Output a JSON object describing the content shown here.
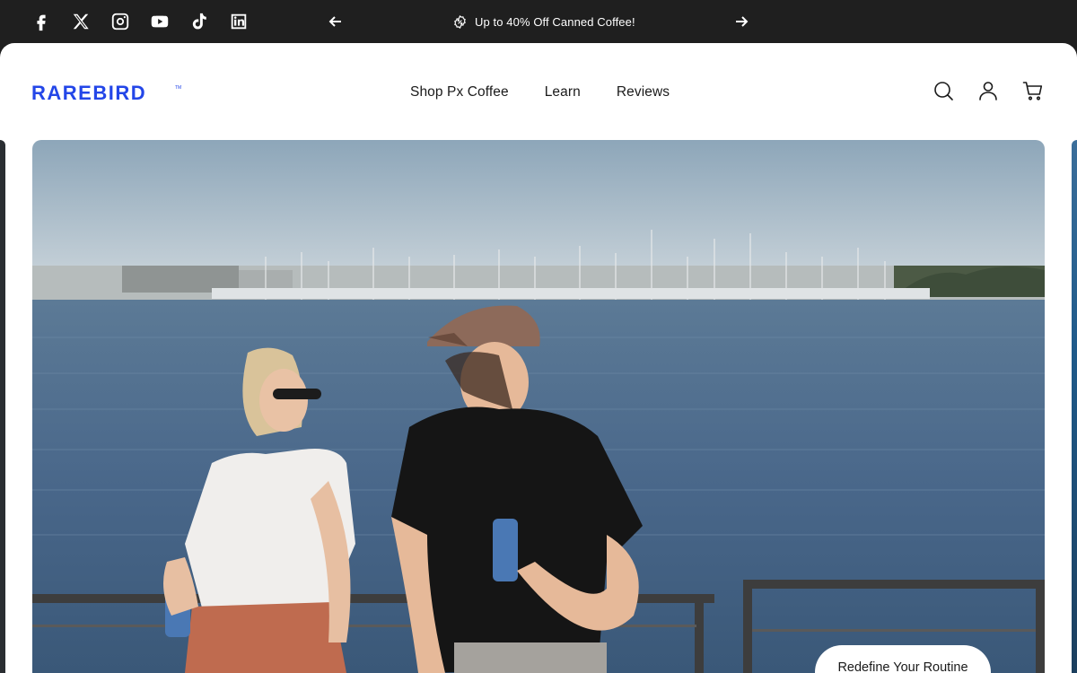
{
  "topbar": {
    "socials": [
      {
        "icon": "facebook-icon"
      },
      {
        "icon": "x-icon"
      },
      {
        "icon": "instagram-icon"
      },
      {
        "icon": "youtube-icon"
      },
      {
        "icon": "tiktok-icon"
      },
      {
        "icon": "linkedin-icon"
      }
    ],
    "promo_text": "Up to 40% Off Canned Coffee!",
    "promo_icon": "discount-badge-icon",
    "prev_icon": "arrow-left-icon",
    "next_icon": "arrow-right-icon"
  },
  "header": {
    "logo_text": "RAREBIRD",
    "nav": [
      {
        "label": "Shop Px Coffee"
      },
      {
        "label": "Learn"
      },
      {
        "label": "Reviews"
      }
    ],
    "icons": [
      "search-icon",
      "account-icon",
      "cart-icon"
    ]
  },
  "hero": {
    "cta_label": "Redefine Your Routine"
  },
  "colors": {
    "brand_blue": "#2346e8",
    "topbar_bg": "#1f1f1f",
    "panel_bg": "#ffffff"
  }
}
